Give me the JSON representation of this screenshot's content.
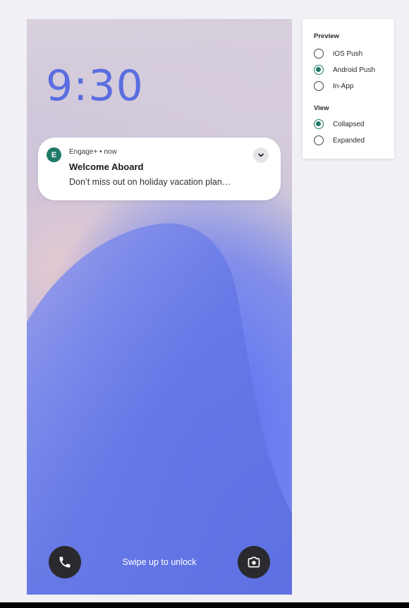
{
  "lockscreen": {
    "time": "9:30",
    "swipe_text": "Swipe up to unlock",
    "phone_icon": "phone-icon",
    "camera_icon": "camera-icon"
  },
  "notification": {
    "app_initial": "E",
    "meta": "Engage+ • now",
    "title": "Welcome Aboard",
    "body": "Don’t miss out on holiday vacation plan…",
    "expand_icon": "chevron-down-icon"
  },
  "panel": {
    "preview_label": "Preview",
    "preview_options": [
      {
        "label": "iOS Push",
        "selected": false
      },
      {
        "label": "Android Push",
        "selected": true
      },
      {
        "label": "In-App",
        "selected": false
      }
    ],
    "view_label": "View",
    "view_options": [
      {
        "label": "Collapsed",
        "selected": true
      },
      {
        "label": "Expanded",
        "selected": false
      }
    ]
  },
  "colors": {
    "accent": "#1f7a68",
    "clock": "#5b6ee0",
    "background": "#f0f0f5"
  }
}
